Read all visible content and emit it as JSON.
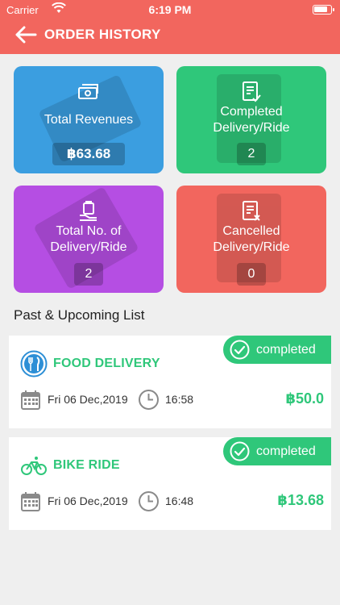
{
  "status_bar": {
    "carrier": "Carrier",
    "time": "6:19 PM"
  },
  "header": {
    "title": "ORDER HISTORY"
  },
  "stats": {
    "total_revenues": {
      "label": "Total Revenues",
      "value": "฿63.68"
    },
    "completed": {
      "label_line1": "Completed",
      "label_line2": "Delivery/Ride",
      "value": "2"
    },
    "total_count": {
      "label_line1": "Total No. of",
      "label_line2": "Delivery/Ride",
      "value": "2"
    },
    "cancelled": {
      "label_line1": "Cancelled",
      "label_line2": "Delivery/Ride",
      "value": "0"
    }
  },
  "section": {
    "title": "Past & Upcoming List"
  },
  "orders": [
    {
      "type": "FOOD DELIVERY",
      "icon": "food-delivery-icon",
      "status": "completed",
      "date": "Fri 06 Dec,2019",
      "time": "16:58",
      "price": "฿50.0"
    },
    {
      "type": "BIKE RIDE",
      "icon": "bike-icon",
      "status": "completed",
      "date": "Fri 06 Dec,2019",
      "time": "16:48",
      "price": "฿13.68"
    }
  ],
  "colors": {
    "header": "#f2665e",
    "blue": "#3b9ee0",
    "green": "#2fc77a",
    "purple": "#b54ee3",
    "red": "#f2665e"
  }
}
